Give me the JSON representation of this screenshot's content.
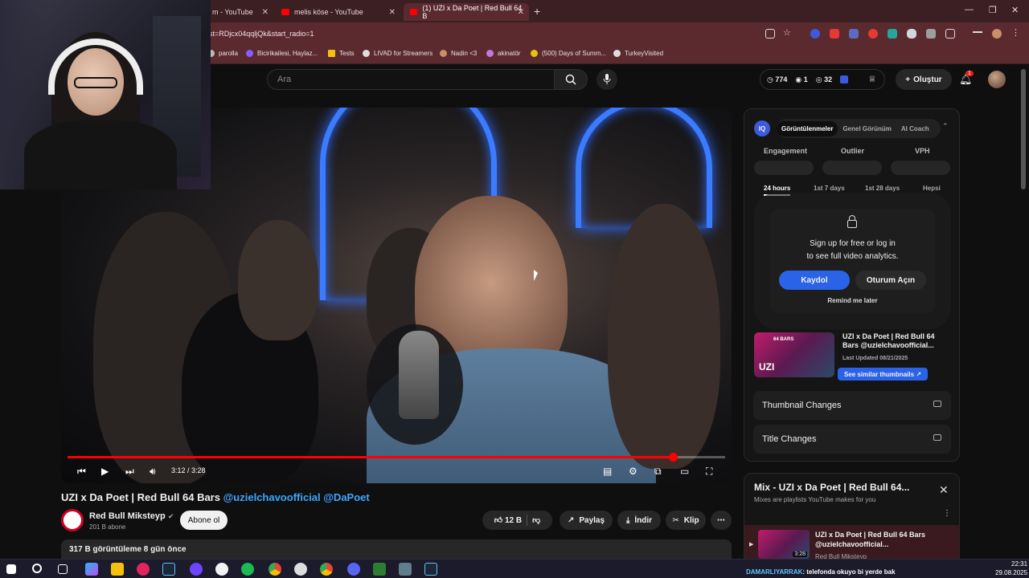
{
  "browser": {
    "tabs": [
      {
        "label": "m - YouTube"
      },
      {
        "label": "melis köse - YouTube"
      },
      {
        "label": "(1) UZI x Da Poet | Red Bull 64 B"
      }
    ],
    "url": "st=RDjcx04qqljQk&start_radio=1",
    "bookmarks": [
      {
        "label": "parolla",
        "color": "#bbbbbb"
      },
      {
        "label": "Bicirikailesi, Haylaz...",
        "color": "#8a5cff"
      },
      {
        "label": "Tests",
        "color": "#f4c20d"
      },
      {
        "label": "LIVAD for Streamers",
        "color": "#dddddd"
      },
      {
        "label": "Nadin <3",
        "color": "#c98e6a"
      },
      {
        "label": "akinatör",
        "color": "#c07ad8"
      },
      {
        "label": "(500) Days of Summ...",
        "color": "#e8c400"
      },
      {
        "label": "TurkeyVisited",
        "color": "#dddddd"
      }
    ]
  },
  "header": {
    "search_placeholder": "Ara",
    "stats": {
      "views": "774",
      "users": "1",
      "watching": "32"
    },
    "create_label": "Oluştur",
    "notifications": "1"
  },
  "player": {
    "time": "3:12 / 3:28",
    "progress": 0.92
  },
  "video": {
    "title": "UZI x Da Poet | Red Bull 64 Bars",
    "tags": "@uzielchavoofficial @DaPoet",
    "channel": "Red Bull Miksteyp",
    "subscribers": "201 B abone",
    "subscribe_label": "Abone ol",
    "likes": "12 B",
    "share_label": "Paylaş",
    "download_label": "İndir",
    "clip_label": "Klip",
    "views_line": "317 B görüntüleme  8 gün önce"
  },
  "analytics": {
    "logo": "IQ",
    "tabs": [
      "Görüntülenmeler",
      "Genel Görünüm",
      "AI Coach"
    ],
    "metrics": [
      "Engagement",
      "Outlier",
      "VPH"
    ],
    "ranges": [
      "24 hours",
      "1st 7 days",
      "1st 28 days",
      "Hepsi"
    ],
    "lock_line1": "Sign up for free or log in",
    "lock_line2": "to see full video analytics.",
    "signup_label": "Kaydol",
    "login_label": "Oturum Açın",
    "remind_label": "Remind me later",
    "thumb_title": "UZI x Da Poet | Red Bull 64 Bars @uzielchavoofficial...",
    "thumb_updated": "Last Updated 08/21/2025",
    "similar_label": "See similar thumbnails  ↗",
    "thumb_badge": "64 BARS",
    "thumb_uzi": "UZI",
    "row1": "Thumbnail Changes",
    "row2": "Title Changes"
  },
  "mix": {
    "title": "Mix - UZI x Da Poet | Red Bull 64...",
    "subtitle": "Mixes are playlists YouTube makes for you",
    "item_title": "UZI x Da Poet | Red Bull 64 Bars @uzielchavoofficial...",
    "item_channel": "Red Bull Miksteyp",
    "item_duration": "3:28"
  },
  "taskbar": {
    "ticker_user": "DAMARLIYARRAK",
    "ticker_msg": ": telefonda okuyo bi yerde bak",
    "time": "22:31",
    "date": "29.08.2025"
  }
}
